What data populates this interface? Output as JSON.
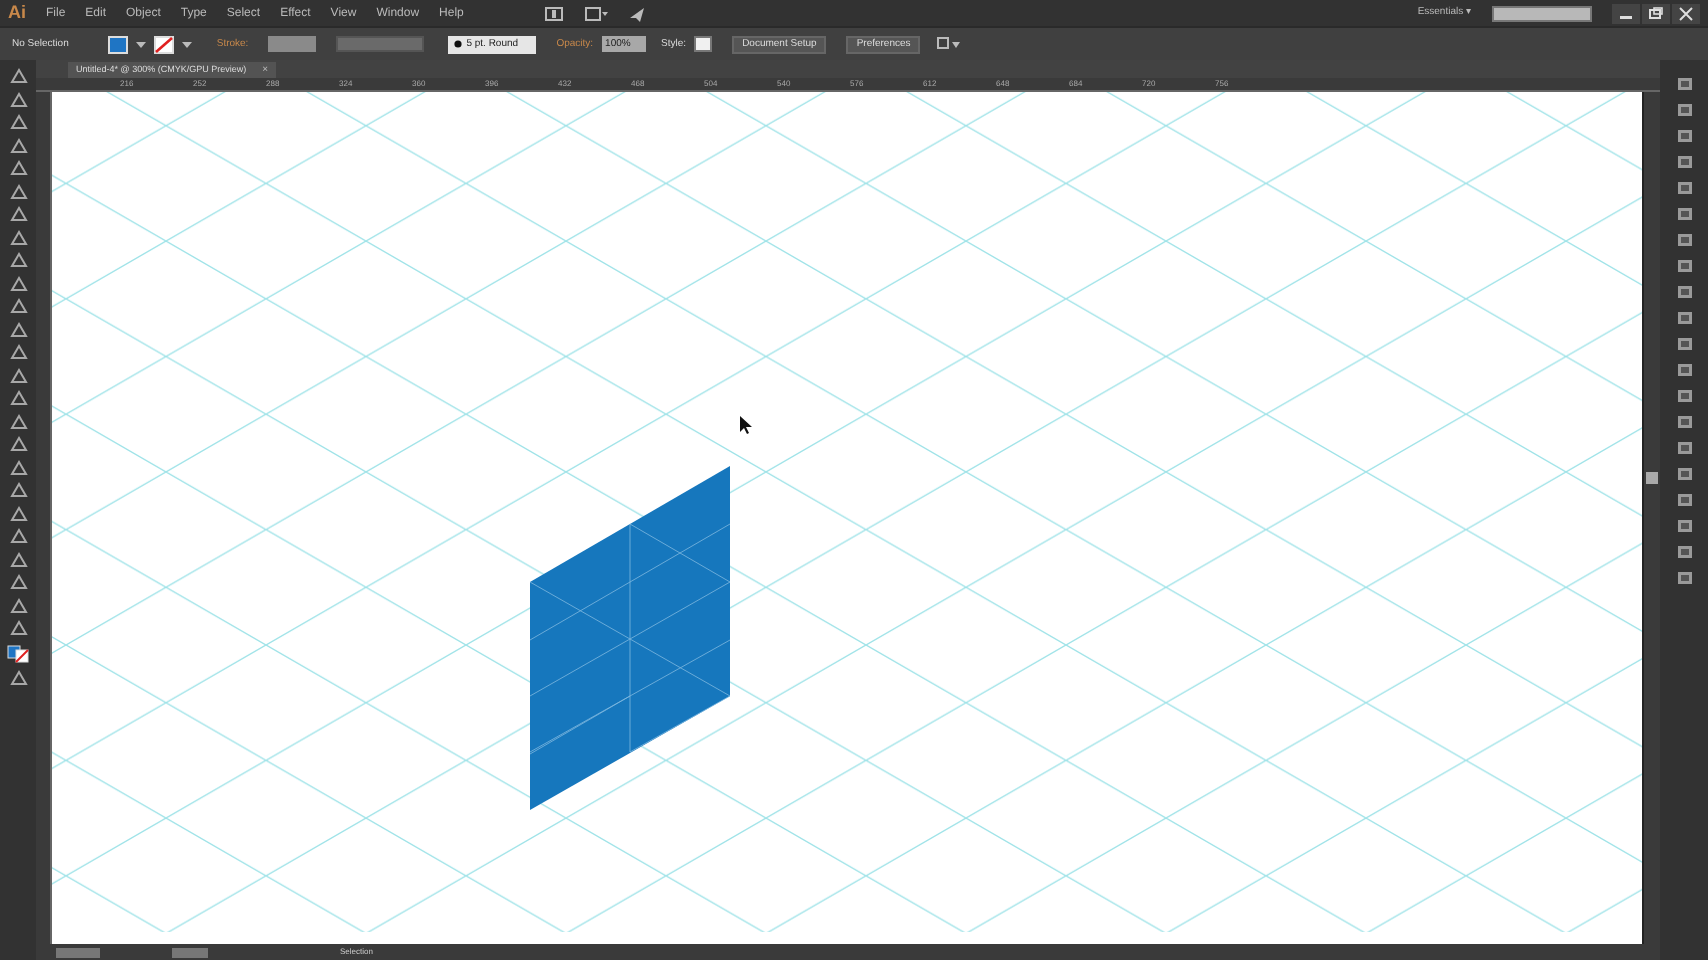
{
  "app": {
    "logo": "Ai",
    "menu": [
      "File",
      "Edit",
      "Object",
      "Type",
      "Select",
      "Effect",
      "View",
      "Window",
      "Help"
    ],
    "workspace": "Essentials",
    "workspace_caret": "▾"
  },
  "control_bar": {
    "selection": "No Selection",
    "stroke_label": "Stroke:",
    "brush": "5 pt. Round",
    "opacity_label": "Opacity:",
    "opacity": "100%",
    "style_label": "Style:",
    "buttons": [
      "Document Setup",
      "Preferences"
    ]
  },
  "document_tab": {
    "title": "Untitled-4* @ 300% (CMYK/GPU Preview)",
    "close": "×"
  },
  "ruler": {
    "ticks": [
      "216",
      "252",
      "288",
      "324",
      "360",
      "396",
      "432",
      "468",
      "504",
      "540",
      "576",
      "612",
      "648",
      "684",
      "720",
      "756"
    ]
  },
  "status_bar": {
    "tool": "Selection"
  }
}
